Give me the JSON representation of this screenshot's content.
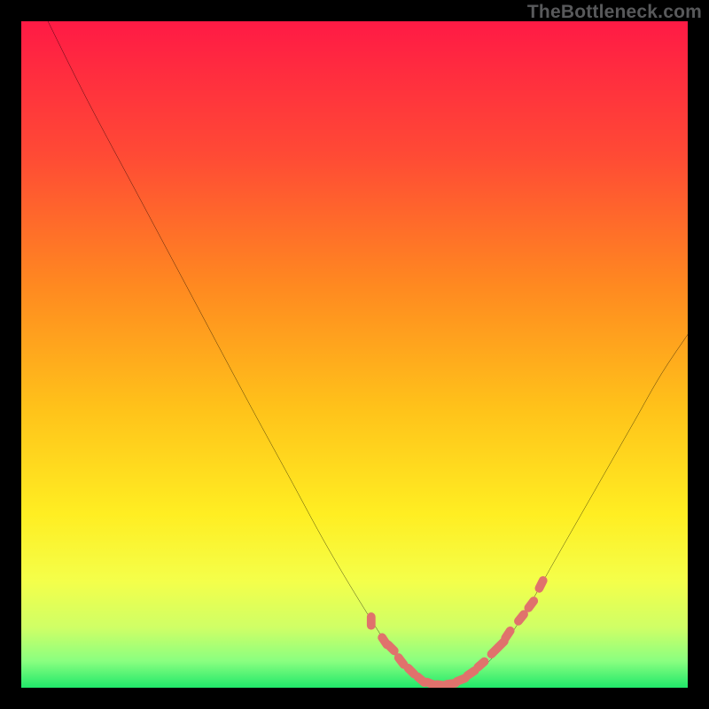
{
  "watermark": "TheBottleneck.com",
  "chart_data": {
    "type": "line",
    "title": "",
    "xlabel": "",
    "ylabel": "",
    "xlim": [
      0,
      100
    ],
    "ylim": [
      0,
      100
    ],
    "series": [
      {
        "name": "curve",
        "x": [
          4,
          10,
          18,
          26,
          34,
          40,
          46,
          52,
          56,
          59,
          62,
          65,
          68,
          72,
          76,
          80,
          84,
          88,
          92,
          96,
          100
        ],
        "y": [
          100,
          88,
          73,
          58,
          43,
          32,
          21,
          11,
          5,
          2,
          0.5,
          0.5,
          2,
          6,
          12,
          19,
          26,
          33,
          40,
          47,
          53
        ]
      }
    ],
    "markers": {
      "name": "highlight-dots",
      "color": "#e0726c",
      "x": [
        52.5,
        54.5,
        55.5,
        57.0,
        58.5,
        60.0,
        61.5,
        63.0,
        64.5,
        66.0,
        67.5,
        69.0,
        71.0,
        72.0,
        73.0,
        75.0,
        76.5,
        78.0
      ],
      "y": [
        10.0,
        7.0,
        6.0,
        4.0,
        2.5,
        1.2,
        0.6,
        0.4,
        0.6,
        1.2,
        2.2,
        3.5,
        5.5,
        6.5,
        8.0,
        10.5,
        12.5,
        15.5
      ]
    },
    "gradient_stops": [
      {
        "offset": 0.0,
        "color": "#ff1a45"
      },
      {
        "offset": 0.2,
        "color": "#ff4a35"
      },
      {
        "offset": 0.4,
        "color": "#ff8a20"
      },
      {
        "offset": 0.58,
        "color": "#ffc21a"
      },
      {
        "offset": 0.74,
        "color": "#ffee22"
      },
      {
        "offset": 0.84,
        "color": "#f4ff4a"
      },
      {
        "offset": 0.91,
        "color": "#cfff66"
      },
      {
        "offset": 0.96,
        "color": "#8aff80"
      },
      {
        "offset": 1.0,
        "color": "#20e86a"
      }
    ]
  }
}
